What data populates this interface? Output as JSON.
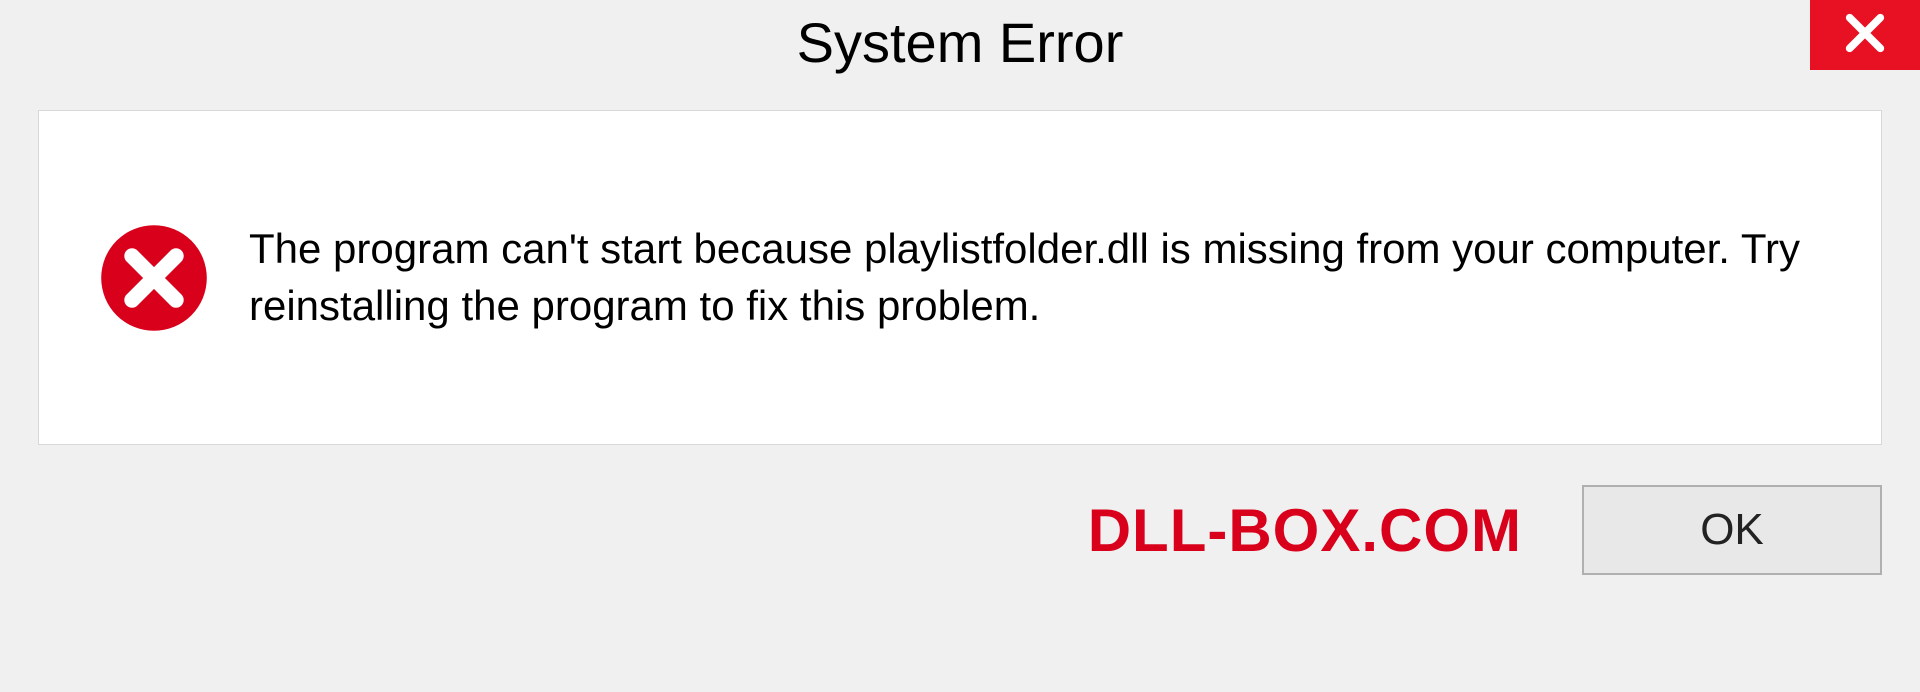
{
  "dialog": {
    "title": "System Error",
    "message": "The program can't start because playlistfolder.dll is missing from your computer. Try reinstalling the program to fix this problem.",
    "ok_label": "OK"
  },
  "brand": {
    "text": "DLL-BOX.COM"
  },
  "colors": {
    "close_bg": "#e81123",
    "error_red": "#d9001b",
    "brand_red": "#d9001b"
  }
}
